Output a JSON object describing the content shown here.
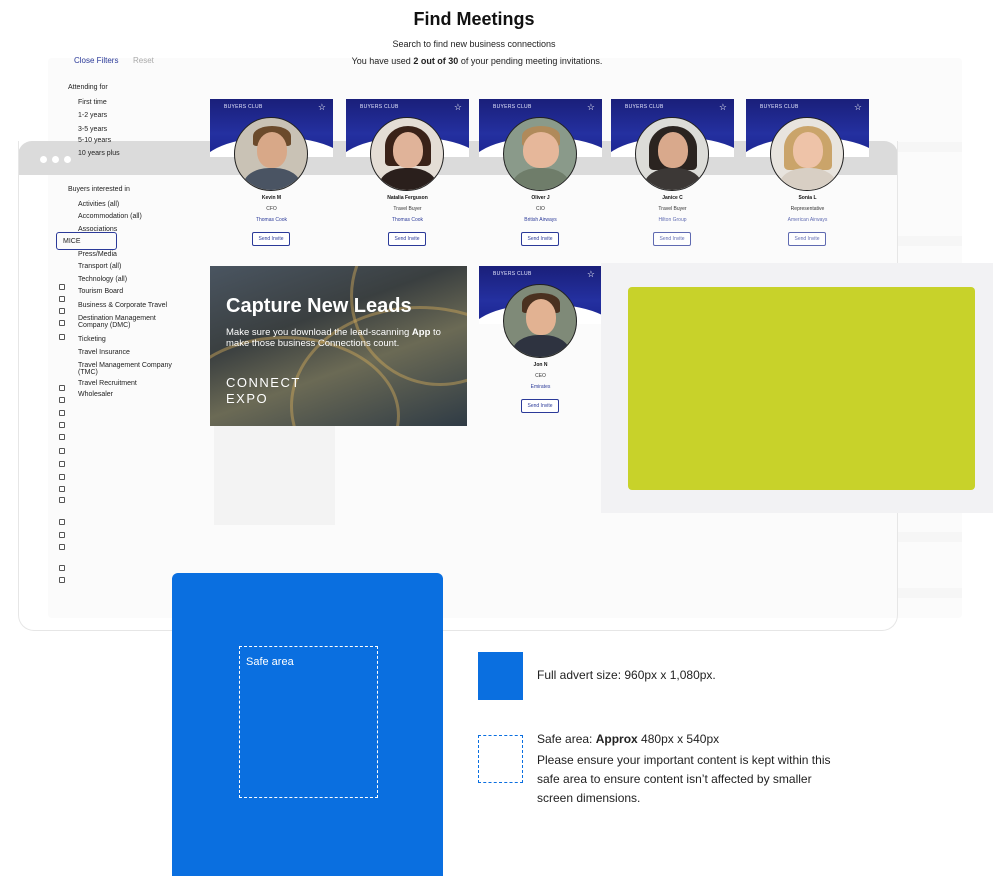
{
  "header": {
    "title": "Find Meetings",
    "subtitle": "Search to find new business connections",
    "usage_prefix": "You have used ",
    "usage_count": "2 out of 30",
    "usage_suffix": " of your pending meeting invitations."
  },
  "filters": {
    "close_label": "Close Filters",
    "reset_label": "Reset",
    "attending_heading": "Attending for",
    "attending_options": [
      "First time",
      "1-2 years",
      "3-5 years",
      "5-10 years",
      "10 years plus"
    ],
    "buyers_heading": "Buyers interested in",
    "buyer_categories": [
      "Activities (all)",
      "Accommodation (all)",
      "Associations",
      "MICE",
      "Press/Media",
      "Transport (all)",
      "Technology (all)",
      "Tourism Board",
      "Business & Corporate Travel",
      "Destination Management",
      "Company (DMC)",
      "Ticketing",
      "Travel Insurance",
      "Travel Management Company",
      "(TMC)",
      "Travel Recruitment",
      "Wholesaler"
    ]
  },
  "cards": [
    {
      "banner": "BUYERS CLUB",
      "name": "Kevin M",
      "role": "CFO",
      "company": "Thomas Cook",
      "button": "Send Invite"
    },
    {
      "banner": "BUYERS CLUB",
      "name": "Natalia Ferguson",
      "role": "Travel Buyer",
      "company": "Thomas Cook",
      "button": "Send Invite"
    },
    {
      "banner": "BUYERS CLUB",
      "name": "Oliver J",
      "role": "CIO",
      "company": "British Airways",
      "button": "Send Invite"
    },
    {
      "banner": "BUYERS CLUB",
      "name": "Janice C",
      "role": "Travel Buyer",
      "company": "Hilton Group",
      "button": "Send Invite"
    },
    {
      "banner": "BUYERS CLUB",
      "name": "Sonia L",
      "role": "Representative",
      "company": "American Airways",
      "button": "Send Invite"
    },
    {
      "banner": "BUYERS CLUB",
      "name": "Jon N",
      "role": "CEO",
      "company": "Emirates",
      "button": "Send Invite"
    }
  ],
  "lead_capture": {
    "title": "Capture New Leads",
    "body_prefix": "Make sure you download the lead-scanning ",
    "body_bold": "App",
    "body_suffix": " to make those business Connections count.",
    "logo_line1": "CONNECT",
    "logo_line2": "EXPO"
  },
  "advert_guide": {
    "safe_area_label": "Safe area",
    "full_size_text": "Full advert size: 960px x 1,080px.",
    "safe_prefix": "Safe area: ",
    "safe_bold": "Approx",
    "safe_size": " 480px x 540px",
    "safe_description": "Please ensure your important content is kept within this safe area to ensure content isn’t affected by smaller screen dimensions."
  },
  "colors": {
    "accent": "#2b3a99",
    "card_banner": "#1a1f7a",
    "advert_blue": "#0a6fe0",
    "ad_placeholder": "#c8d22a"
  },
  "icons": {
    "favorite": "star-outline-icon",
    "window_controls": "window-dots-icon"
  }
}
